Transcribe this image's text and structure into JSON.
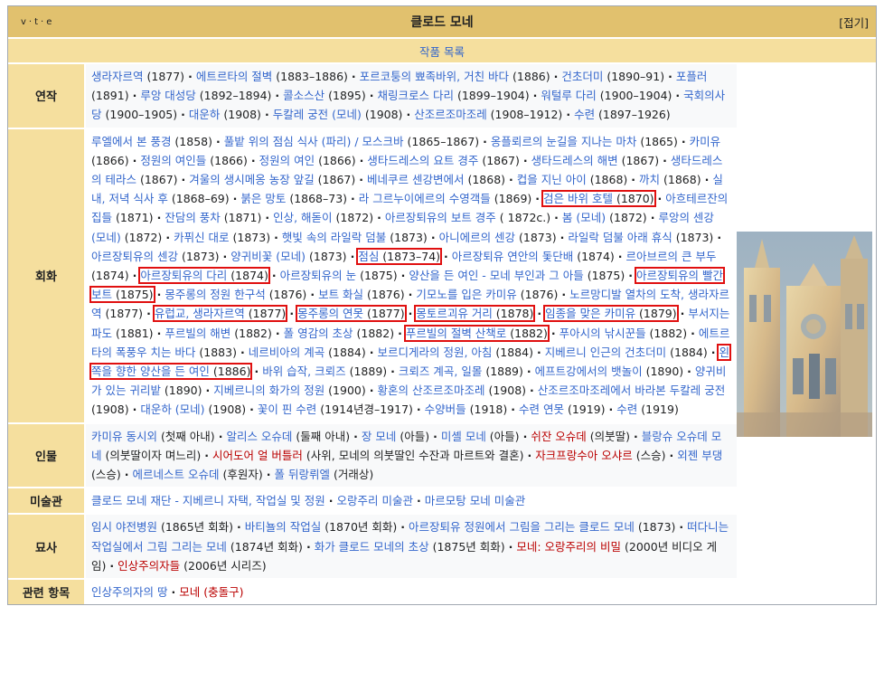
{
  "navbox": {
    "vte": [
      "v",
      "t",
      "e"
    ],
    "title": "클로드 모네",
    "collapse_label": "[접기]",
    "subtitle": "작품 목록"
  },
  "groups": [
    {
      "label": "연작",
      "items": [
        {
          "t": "생라자르역",
          "p": " (1877)"
        },
        {
          "t": "에트르타의 절벽",
          "p": " (1883–1886)"
        },
        {
          "t": "포르코퉁의 뾰족바위, 거친 바다",
          "p": " (1886)"
        },
        {
          "t": "건초더미",
          "p": " (1890–91)"
        },
        {
          "t": "포플러",
          "p": " (1891)"
        },
        {
          "t": "루앙 대성당",
          "p": " (1892–1894)"
        },
        {
          "t": "콜소스산",
          "p": " (1895)"
        },
        {
          "t": "채링크로스 다리",
          "p": " (1899–1904)"
        },
        {
          "t": "워털루 다리",
          "p": " (1900–1904)"
        },
        {
          "t": "국회의사당",
          "p": " (1900–1905)"
        },
        {
          "t": "대운하",
          "p": " (1908)"
        },
        {
          "t": "두칼레 궁전 (모네)",
          "p": " (1908)"
        },
        {
          "t": "산조르조마조레",
          "p": " (1908–1912)"
        },
        {
          "t": "수련",
          "p": " (1897–1926)"
        }
      ]
    },
    {
      "label": "회화",
      "items": [
        {
          "t": "루엘에서 본 풍경",
          "p": " (1858)"
        },
        {
          "t": "풀밭 위의 점심 식사 (파리) / 모스크바",
          "p": " (1865–1867)"
        },
        {
          "t": "옹플뢰르의 눈길을 지나는 마차",
          "p": " (1865)"
        },
        {
          "t": "카미유",
          "p": " (1866)"
        },
        {
          "t": "정원의 여인들",
          "p": " (1866)"
        },
        {
          "t": "정원의 여인",
          "p": " (1866)"
        },
        {
          "t": "생타드레스의 요트 경주",
          "p": " (1867)"
        },
        {
          "t": "생타드레스의 해변",
          "p": " (1867)"
        },
        {
          "t": "생타드레스의 테라스",
          "p": " (1867)"
        },
        {
          "t": "겨울의 생시메옹 농장 앞길",
          "p": " (1867)"
        },
        {
          "t": "베네쿠르 센강변에서",
          "p": " (1868)"
        },
        {
          "t": "컵을 지닌 아이",
          "p": " (1868)"
        },
        {
          "t": "까치",
          "p": " (1868)"
        },
        {
          "t": "실내, 저녁 식사 후",
          "p": " (1868–69)"
        },
        {
          "t": "붉은 망토",
          "p": " (1868–73)"
        },
        {
          "t": "라 그르누이에르의 수영객들",
          "p": " (1869)"
        },
        {
          "t": "검은 바위 호텔",
          "p": " (1870)",
          "hl": true
        },
        {
          "t": "아흐테르잔의 집들",
          "p": " (1871)"
        },
        {
          "t": "잔담의 풍차",
          "p": " (1871)"
        },
        {
          "t": "인상, 해돋이",
          "p": " (1872)"
        },
        {
          "t": "아르장퇴유의 보트 경주",
          "p": " ( 1872c.)"
        },
        {
          "t": "봄 (모네)",
          "p": " (1872)"
        },
        {
          "t": "루앙의 센강 (모네)",
          "p": " (1872)"
        },
        {
          "t": "카퓌신 대로",
          "p": " (1873)"
        },
        {
          "t": "햇빛 속의 라일락 덤불",
          "p": " (1873)"
        },
        {
          "t": "아니에르의 센강",
          "p": " (1873)"
        },
        {
          "t": "라일락 덤불 아래 휴식",
          "p": " (1873)"
        },
        {
          "t": "아르장퇴유의 센강",
          "p": " (1873)"
        },
        {
          "t": "양귀비꽃 (모네)",
          "p": " (1873)"
        },
        {
          "t": "점심",
          "p": " (1873–74)",
          "hl": true
        },
        {
          "t": "아르장퇴유 연안의 돛단배",
          "p": " (1874)"
        },
        {
          "t": "르아브르의 큰 부두",
          "p": " (1874)"
        },
        {
          "t": "아르장퇴유의 다리",
          "p": " (1874)",
          "hl": true
        },
        {
          "t": "아르장퇴유의 눈",
          "p": " (1875)"
        },
        {
          "t": "양산을 든 여인 - 모네 부인과 그 아들",
          "p": " (1875)"
        },
        {
          "t": "아르장퇴유의 빨간 보트",
          "p": " (1875)",
          "hl": true
        },
        {
          "t": "몽주롱의 정원 한구석",
          "p": " (1876)"
        },
        {
          "t": "보트 화실",
          "p": " (1876)"
        },
        {
          "t": "기모노를 입은 카미유",
          "p": " (1876)"
        },
        {
          "t": "노르망디발 열차의 도착, 생라자르역",
          "p": " (1877)"
        },
        {
          "t": "유럽교, 생라자르역",
          "p": " (1877)",
          "hl": true
        },
        {
          "t": "몽주롱의 연못",
          "p": " (1877)",
          "hl": true
        },
        {
          "t": "몽토르괴유 거리",
          "p": " (1878)",
          "hl": true
        },
        {
          "t": "임종을 맞은 카미유",
          "p": " (1879)",
          "hl": true
        },
        {
          "t": "부서지는 파도",
          "p": " (1881)"
        },
        {
          "t": "푸르빌의 해변",
          "p": " (1882)"
        },
        {
          "t": "폴 영감의 초상",
          "p": " (1882)"
        },
        {
          "t": "푸르빌의 절벽 산책로",
          "p": " (1882)",
          "hl": true
        },
        {
          "t": "푸아시의 낚시꾼들",
          "p": " (1882)"
        },
        {
          "t": "에트르타의 폭풍우 치는 바다",
          "p": " (1883)"
        },
        {
          "t": "네르비아의 계곡",
          "p": " (1884)"
        },
        {
          "t": "보르디게라의 정원, 아침",
          "p": " (1884)"
        },
        {
          "t": "지베르니 인근의 건초더미",
          "p": " (1884)"
        },
        {
          "t": "왼쪽을 향한 양산을 든 여인",
          "p": " (1886)",
          "hl": true
        },
        {
          "t": "바위 습작, 크뢰즈",
          "p": " (1889)"
        },
        {
          "t": "크뢰즈 계곡, 일몰",
          "p": " (1889)"
        },
        {
          "t": "에프트강에서의 뱃놀이",
          "p": " (1890)"
        },
        {
          "t": "양귀비가 있는 귀리밭",
          "p": " (1890)"
        },
        {
          "t": "지베르니의 화가의 정원",
          "p": " (1900)"
        },
        {
          "t": "황혼의 산조르조마조레",
          "p": " (1908)"
        },
        {
          "t": "산조르조마조레에서 바라본 두칼레 궁전",
          "p": " (1908)"
        },
        {
          "t": "대운하 (모네)",
          "p": " (1908)"
        },
        {
          "t": "꽃이 핀 수련",
          "p": " (1914년경–1917)"
        },
        {
          "t": "수양버들",
          "p": " (1918)"
        },
        {
          "t": "수련 연못",
          "p": " (1919)"
        },
        {
          "t": "수련",
          "p": " (1919)"
        }
      ]
    },
    {
      "label": "인물",
      "items": [
        {
          "t": "카미유 동시외",
          "p": " (첫째 아내)"
        },
        {
          "t": "알리스 오슈데",
          "p": " (둘째 아내)"
        },
        {
          "t": "장 모네",
          "p": " (아들)"
        },
        {
          "t": "미셸 모네",
          "p": " (아들)"
        },
        {
          "t": "쉬잔 오슈데",
          "p": " (의붓딸)",
          "red": true
        },
        {
          "t": "블랑슈 오슈데 모네",
          "p": " (의붓딸이자 며느리)"
        },
        {
          "t": "시어도어 얼 버틀러",
          "p": " (사위, 모네의 의붓딸인 수잔과 마르트와 결혼)",
          "red": true
        },
        {
          "t": "자크프랑수아 오샤르",
          "p": " (스승)",
          "red": true
        },
        {
          "t": "외젠 부댕",
          "p": " (스승)"
        },
        {
          "t": "에르네스트 오슈데",
          "p": " (후원자)"
        },
        {
          "t": "폴 뒤랑뤼엘",
          "p": " (거래상)"
        }
      ]
    },
    {
      "label": "미술관",
      "items": [
        {
          "t": "클로드 모네 재단 - 지베르니 자택, 작업실 및 정원",
          "p": ""
        },
        {
          "t": "오랑주리 미술관",
          "p": ""
        },
        {
          "t": "마르모탕 모네 미술관",
          "p": ""
        }
      ]
    },
    {
      "label": "묘사",
      "items": [
        {
          "t": "임시 야전병원",
          "p": " (1865년 회화)"
        },
        {
          "t": "바티뇰의 작업실",
          "p": " (1870년 회화)"
        },
        {
          "t": "아르장퇴유 정원에서 그림을 그리는 클로드 모네",
          "p": " (1873)"
        },
        {
          "t": "떠다니는 작업실에서 그림 그리는 모네",
          "p": " (1874년 회화)"
        },
        {
          "t": "화가 클로드 모네의 초상",
          "p": " (1875년 회화)"
        },
        {
          "t": "모네: 오랑주리의 비밀",
          "p": " (2000년 비디오 게임)",
          "red": true
        },
        {
          "t": "인상주의자들",
          "p": " (2006년 시리즈)",
          "red": true
        }
      ]
    },
    {
      "label": "관련 항목",
      "items": [
        {
          "t": "인상주의자의 땅",
          "p": ""
        },
        {
          "t": "모네 (충돌구)",
          "p": "",
          "red": true
        }
      ]
    }
  ],
  "colors": {
    "title_bg": "#e1c16e",
    "group_bg": "#f5df9e",
    "link": "#3366cc",
    "redlink": "#ba0000",
    "highlight": "#e01010"
  },
  "image": {
    "icon": "rouen-cathedral-painting"
  }
}
